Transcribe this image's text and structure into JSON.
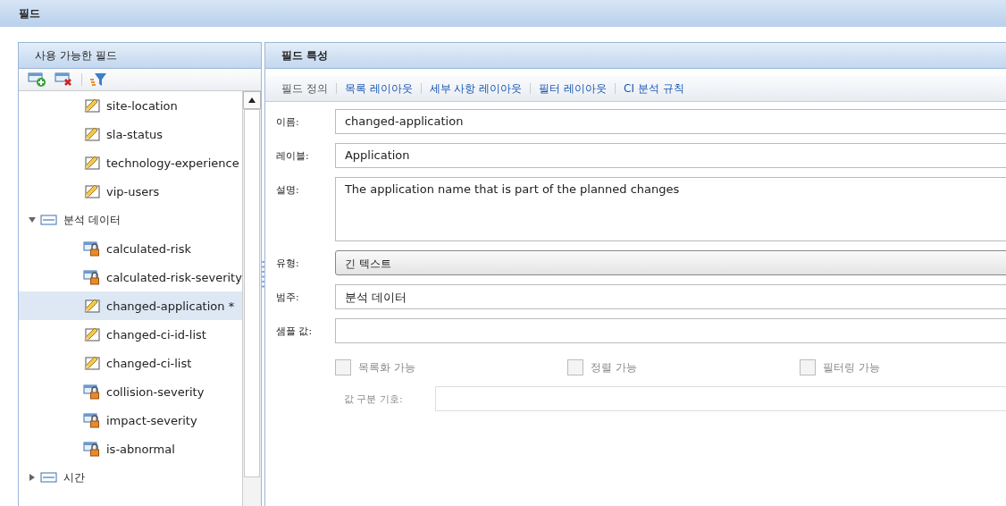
{
  "title": "필드",
  "left_panel": {
    "title": "사용 가능한 필드",
    "tree": [
      {
        "children": [
          {
            "label": "site-location",
            "kind": "editable",
            "selected": false
          },
          {
            "label": "sla-status",
            "kind": "editable",
            "selected": false
          },
          {
            "label": "technology-experience",
            "kind": "editable",
            "selected": false
          },
          {
            "label": "vip-users",
            "kind": "editable",
            "selected": false
          }
        ]
      },
      {
        "label": "분석 데이터",
        "kind": "group",
        "expanded": true,
        "children": [
          {
            "label": "calculated-risk",
            "kind": "locked",
            "selected": false
          },
          {
            "label": "calculated-risk-severity",
            "kind": "locked",
            "selected": false
          },
          {
            "label": "changed-application *",
            "kind": "editable",
            "selected": true
          },
          {
            "label": "changed-ci-id-list",
            "kind": "editable",
            "selected": false
          },
          {
            "label": "changed-ci-list",
            "kind": "editable",
            "selected": false
          },
          {
            "label": "collision-severity",
            "kind": "locked",
            "selected": false
          },
          {
            "label": "impact-severity",
            "kind": "locked",
            "selected": false
          },
          {
            "label": "is-abnormal",
            "kind": "locked",
            "selected": false
          }
        ]
      },
      {
        "label": "시간",
        "kind": "group",
        "expanded": false
      }
    ]
  },
  "right_panel": {
    "title": "필드 특성",
    "tabs": [
      {
        "label": "필드 정의",
        "selected": true
      },
      {
        "label": "목록 레이아웃",
        "selected": false
      },
      {
        "label": "세부 사항 레이아웃",
        "selected": false
      },
      {
        "label": "필터 레이아웃",
        "selected": false
      },
      {
        "label": "CI 분석 규칙",
        "selected": false
      }
    ],
    "fields": [
      {
        "label": "이름:",
        "kind": "text",
        "value": "changed-application"
      },
      {
        "label": "레이블:",
        "kind": "text",
        "value": "Application"
      },
      {
        "label": "설명:",
        "kind": "textarea",
        "value": "The application name that is part of the planned changes"
      },
      {
        "label": "유형:",
        "kind": "select",
        "value": "긴 텍스트"
      },
      {
        "label": "범주:",
        "kind": "text",
        "value": "분석 데이터"
      },
      {
        "label": "샘플 값:",
        "kind": "text"
      }
    ],
    "checkboxes": [
      {
        "label": "목록화 가능",
        "checked": false,
        "disabled": true
      },
      {
        "label": "정렬 가능",
        "checked": false,
        "disabled": true
      },
      {
        "label": "필터링 가능",
        "checked": false,
        "disabled": true
      }
    ],
    "separator_field": {
      "label": "값 구분 기호:",
      "disabled": true
    }
  }
}
